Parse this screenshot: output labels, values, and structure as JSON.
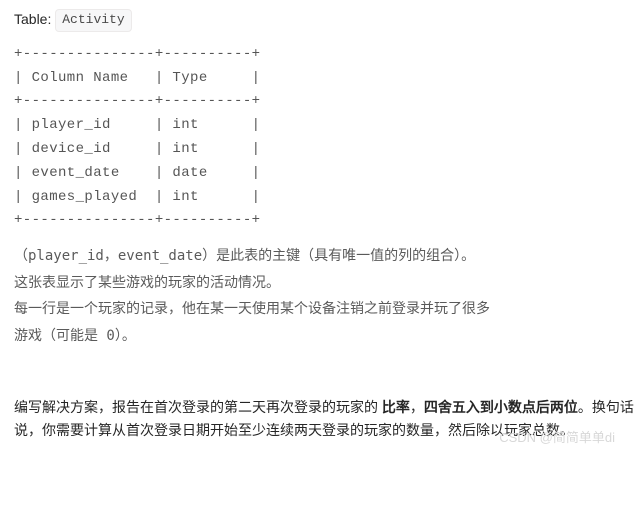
{
  "table": {
    "label": "Table:",
    "name": "Activity"
  },
  "schema": {
    "sep_top": "+---------------+----------+",
    "header_row": "| Column Name   | Type     |",
    "sep_mid": "+---------------+----------+",
    "rows": [
      "| player_id     | int      |",
      "| device_id     | int      |",
      "| event_date    | date     |",
      "| games_played  | int      |"
    ],
    "sep_bot": "+---------------+----------+"
  },
  "explanation": {
    "line1": "（player_id，event_date）是此表的主键（具有唯一值的列的组合）。",
    "line2": "这张表显示了某些游戏的玩家的活动情况。",
    "line3": "每一行是一个玩家的记录，他在某一天使用某个设备注销之前登录并玩了很多",
    "line4": "游戏（可能是 0）。"
  },
  "problem": {
    "p1_a": "编写解决方案，报告在首次登录的第二天再次登录的玩家的 ",
    "p1_strong1": "比率",
    "p1_b": "，",
    "p1_strong2": "四舍五入到小数点后两位",
    "p1_c": "。换句话说，你需要计算从首次登录日期开始至少连续两天登录的玩家的数量，然后除以玩家总数。"
  },
  "watermark": "CSDN @简简单单di"
}
